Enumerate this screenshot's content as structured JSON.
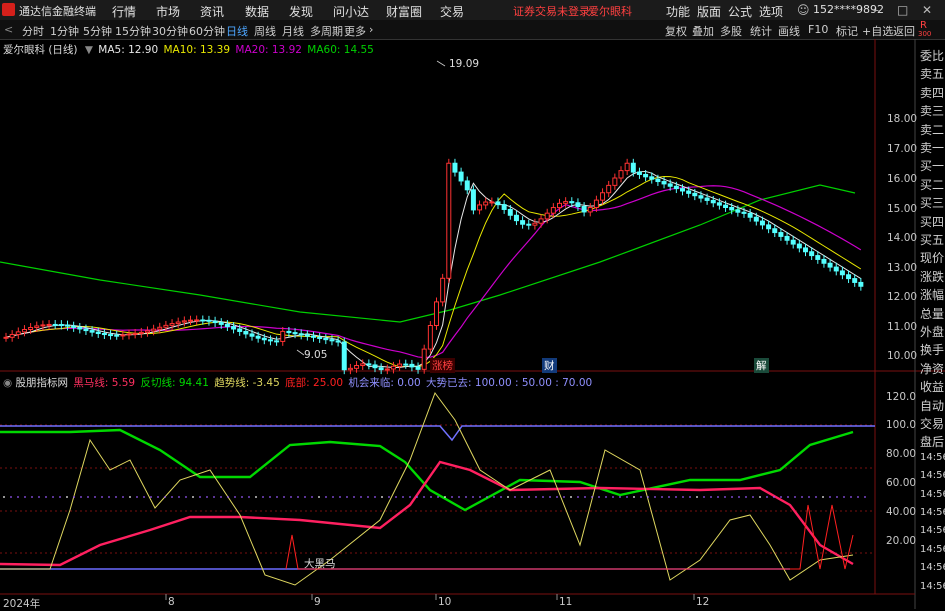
{
  "app": {
    "title": "通达信金融终端"
  },
  "menu": {
    "items": [
      "行情",
      "市场",
      "资讯",
      "数据",
      "发现",
      "问小达",
      "财富圈",
      "交易"
    ],
    "notice": "证券交易未登录",
    "stock": "爱尔眼科",
    "right_items": [
      "功能",
      "版面",
      "公式",
      "选项"
    ],
    "user": "152****9892"
  },
  "toolbar": {
    "periods": [
      "分时",
      "1分钟",
      "5分钟",
      "15分钟",
      "30分钟",
      "60分钟",
      "日线",
      "周线",
      "月线",
      "多周期",
      "更多"
    ],
    "active_period": "日线",
    "buttons": [
      "复权",
      "叠加",
      "多股",
      "统计",
      "画线",
      "F10",
      "标记",
      "+自选",
      "返回"
    ]
  },
  "main_chart": {
    "title": "爱尔眼科 (日线)",
    "ma5": "MA5: 12.90",
    "ma10": "MA10: 13.39",
    "ma20": "MA20: 13.92",
    "ma60": "MA60: 14.55",
    "high_label": "19.09",
    "low_label": "9.05",
    "events": [
      "涨榜",
      "财",
      "解"
    ],
    "y_ticks": [
      "18.00",
      "17.00",
      "16.00",
      "15.00",
      "14.00",
      "13.00",
      "12.00",
      "11.00",
      "10.00"
    ]
  },
  "indicator": {
    "name": "股朋指标网",
    "heima": "黑马线: 5.59",
    "fanqie": "反切线: 94.41",
    "qushi": "趋势线: -3.45",
    "dibu": "底部: 25.00",
    "jihui": "机会来临: 0.00",
    "dashi": "大势已去: 100.00 : 50.00 : 70.00",
    "annotation": "大黑马",
    "y_ticks": [
      "120.0",
      "100.0",
      "80.00",
      "60.00",
      "40.00",
      "20.00"
    ]
  },
  "x_axis": {
    "labels": [
      "2024年",
      "8",
      "9",
      "10",
      "11",
      "12"
    ]
  },
  "side_panel": {
    "items": [
      "委比",
      "卖五",
      "卖四",
      "卖三",
      "卖二",
      "卖一",
      "买一",
      "买二",
      "买三",
      "买四",
      "买五",
      "现价",
      "涨跌",
      "涨幅",
      "总量",
      "外盘",
      "换手",
      "净资",
      "收益",
      "自动",
      "交易",
      "盘后",
      "14:56",
      "14:56",
      "14:56",
      "14:56",
      "14:56",
      "14:56",
      "14:56",
      "14:56"
    ],
    "header_r": "R",
    "header_num": "300"
  },
  "colors": {
    "up": "#ff3232",
    "down": "#54ffff",
    "ma5": "#ffffff",
    "ma10": "#ffff00",
    "ma20": "#ff00ff",
    "ma60": "#00ff00"
  }
}
